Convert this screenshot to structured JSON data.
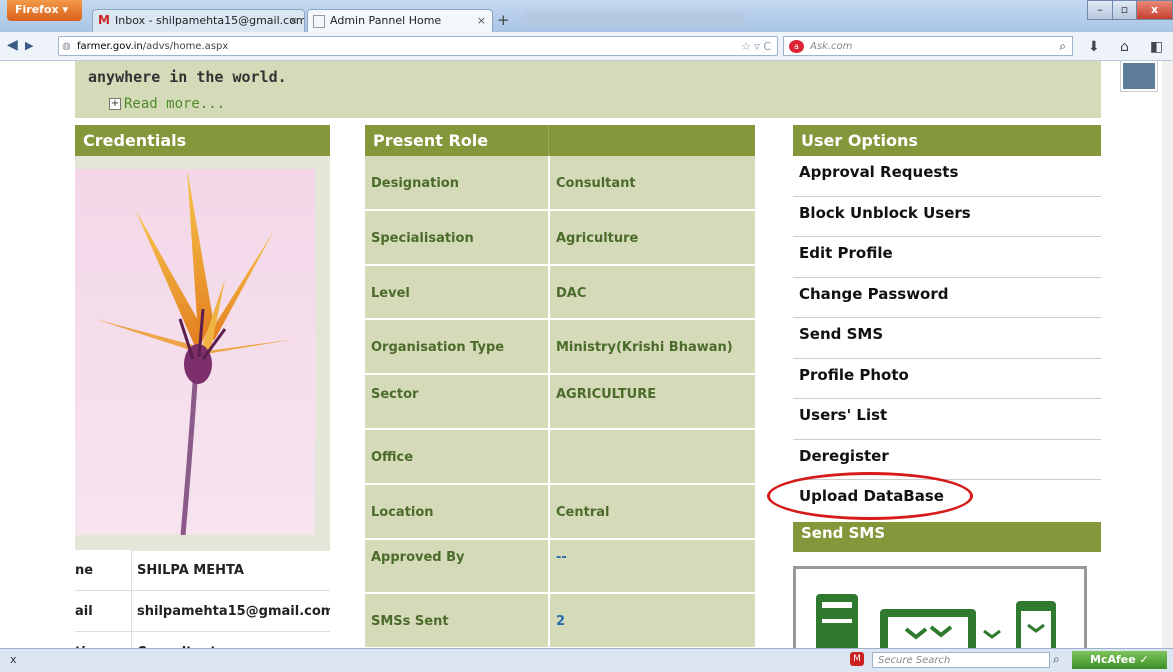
{
  "browser": {
    "menu_label": "Firefox",
    "tabs": [
      {
        "label": "Inbox - shilpamehta15@gmail.com - ..."
      },
      {
        "label": "Admin Pannel Home"
      }
    ],
    "new_tab": "+",
    "url_host": "farmer.gov.in",
    "url_path": "/advs/home.aspx",
    "search_placeholder": "Ask.com",
    "status_close": "x",
    "secure_search_placeholder": "Secure Search",
    "mcafee_label": "McAfee"
  },
  "intro": {
    "text": "anywhere in the world.",
    "read_more": "Read more..."
  },
  "credentials": {
    "title": "Credentials",
    "rows": [
      {
        "key": "ne",
        "value": "SHILPA MEHTA"
      },
      {
        "key": "ail",
        "value": "shilpamehta15@gmail.com"
      },
      {
        "key": "ti",
        "value": "Consultant"
      }
    ]
  },
  "present_role": {
    "title": "Present Role",
    "rows": [
      {
        "key": "Designation",
        "value": "Consultant"
      },
      {
        "key": "Specialisation",
        "value": "Agriculture"
      },
      {
        "key": "Level",
        "value": "DAC"
      },
      {
        "key": "Organisation Type",
        "value": "Ministry(Krishi Bhawan)"
      },
      {
        "key": "Sector",
        "value": "AGRICULTURE"
      },
      {
        "key": "Office",
        "value": ""
      },
      {
        "key": "Location",
        "value": "Central"
      },
      {
        "key": "Approved By",
        "value": "--"
      },
      {
        "key": "SMSs Sent",
        "value": "2"
      }
    ]
  },
  "user_options": {
    "title": "User Options",
    "items": [
      "Approval Requests",
      "Block Unblock Users",
      "Edit Profile",
      "Change Password",
      "Send SMS",
      "Profile Photo",
      "Users' List",
      "Deregister",
      "Upload DataBase"
    ]
  },
  "send_sms": {
    "title": "Send SMS"
  },
  "colors": {
    "section_header": "#84973a",
    "panel_bg": "#d5dab9",
    "highlight_circle": "#d71a1a",
    "link_green": "#4f8a2a"
  }
}
